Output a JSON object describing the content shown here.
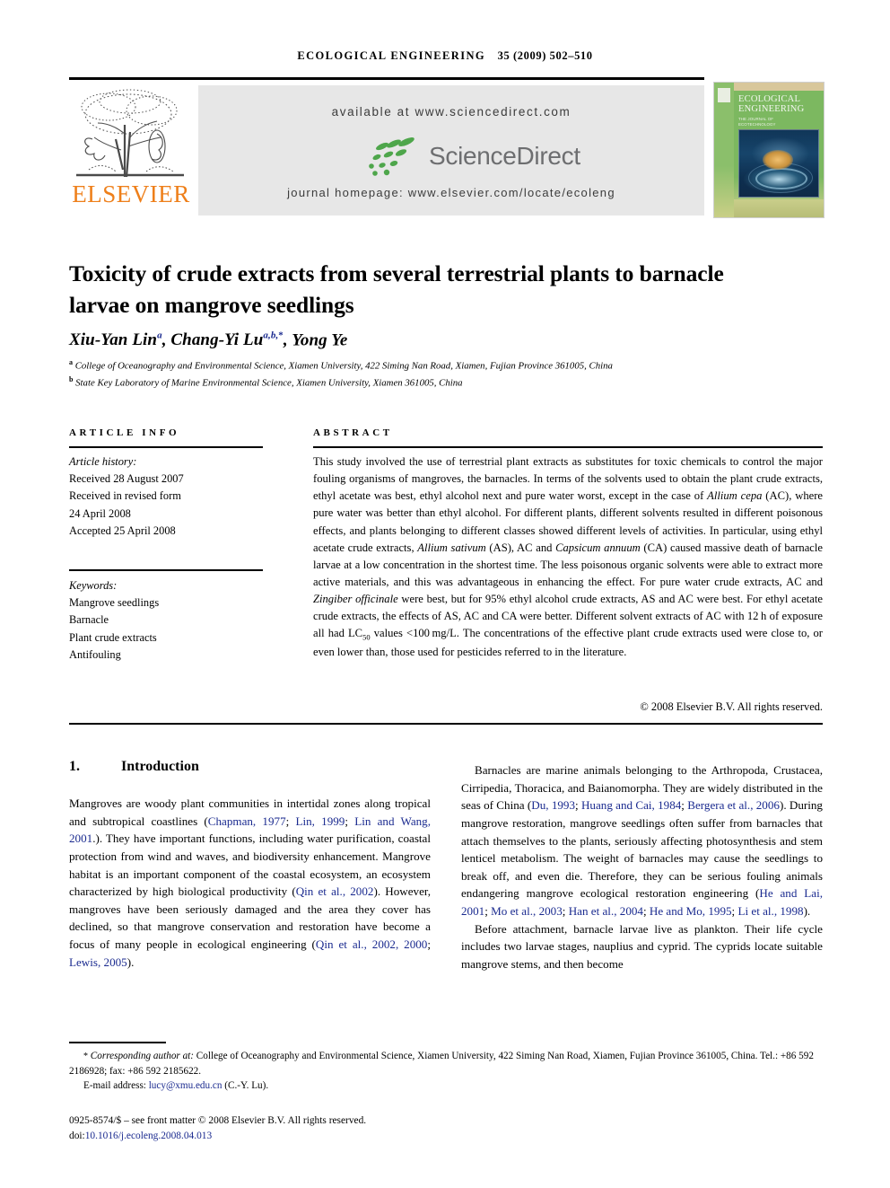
{
  "running_head": {
    "journal": "ECOLOGICAL ENGINEERING",
    "volume_info": "35 (2009) 502–510"
  },
  "masthead": {
    "available_at": "available at www.sciencedirect.com",
    "journal_homepage": "journal homepage: www.elsevier.com/locate/ecoleng",
    "sciencedirect_wordmark": "ScienceDirect",
    "elsevier_wordmark": "ELSEVIER",
    "elsevier_orange": "#EE7F1A",
    "sciencedirect_green": "#4EA64B",
    "sciencedirect_gray": "#6d6e70",
    "cover": {
      "title_line1": "ECOLOGICAL",
      "title_line2": "ENGINEERING",
      "subtitle_line1": "THE JOURNAL OF",
      "subtitle_line2": "ECOTECHNOLOGY"
    }
  },
  "article": {
    "title": "Toxicity of crude extracts from several terrestrial plants to barnacle larvae on mangrove seedlings",
    "authors_plain": "Xiu-Yan Lin a, Chang-Yi Lu a,b,*, Yong Ye",
    "affiliation_a": "College of Oceanography and Environmental Science, Xiamen University, 422 Siming Nan Road, Xiamen, Fujian Province 361005, China",
    "affiliation_b": "State Key Laboratory of Marine Environmental Science, Xiamen University, Xiamen 361005, China"
  },
  "article_info": {
    "heading": "ARTICLE INFO",
    "history_label": "Article history:",
    "history": [
      "Received 28 August 2007",
      "Received in revised form",
      "24 April 2008",
      "Accepted 25 April 2008"
    ],
    "keywords_label": "Keywords:",
    "keywords": [
      "Mangrove seedlings",
      "Barnacle",
      "Plant crude extracts",
      "Antifouling"
    ]
  },
  "abstract": {
    "heading": "ABSTRACT",
    "copyright": "© 2008 Elsevier B.V. All rights reserved."
  },
  "introduction": {
    "number": "1.",
    "heading": "Introduction"
  },
  "footnote": {
    "corresponding_label": "Corresponding author at:",
    "corresponding_text": " College of Oceanography and Environmental Science, Xiamen University, 422 Siming Nan Road, Xiamen, Fujian Province 361005, China. Tel.: +86 592 2186928; fax: +86 592 2185622.",
    "email_label": "E-mail address:",
    "email": "lucy@xmu.edu.cn",
    "email_owner": "(C.-Y. Lu).",
    "issn_line": "0925-8574/$ – see front matter © 2008 Elsevier B.V. All rights reserved.",
    "doi_label": "doi:",
    "doi": "10.1016/j.ecoleng.2008.04.013",
    "link_color": "#1a2a8f"
  }
}
